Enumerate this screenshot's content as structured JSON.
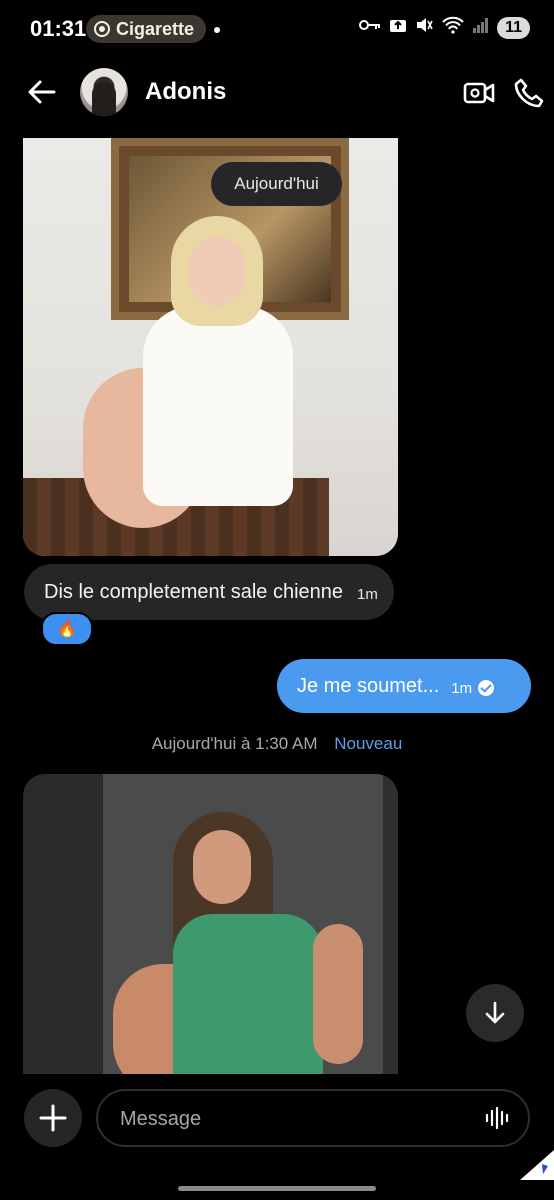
{
  "status_bar": {
    "time": "01:31",
    "media_app": "Cigarette",
    "battery": "11"
  },
  "header": {
    "contact_name": "Adonis"
  },
  "chat": {
    "date_pill": "Aujourd'hui",
    "messages": [
      {
        "direction": "in",
        "text": "Dis le completement sale chienne",
        "time": "1m",
        "reaction": "🔥"
      },
      {
        "direction": "out",
        "text": "Je  me soumet...",
        "time": "1m",
        "status": "read"
      }
    ],
    "separator": {
      "timestamp": "Aujourd'hui à 1:30 AM",
      "new_label": "Nouveau"
    }
  },
  "composer": {
    "placeholder": "Message"
  },
  "colors": {
    "background": "#000000",
    "incoming_bubble": "#262628",
    "outgoing_bubble": "#4a9af0",
    "accent_link": "#5c9eed"
  }
}
